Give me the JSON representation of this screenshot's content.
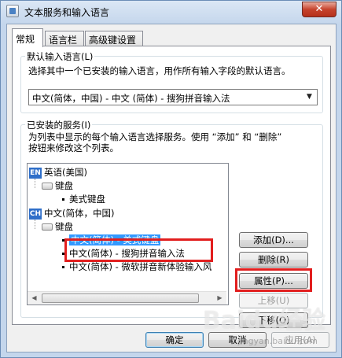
{
  "window": {
    "title": "文本服务和输入语言",
    "close_label": "✕"
  },
  "tabs": [
    {
      "label": "常规",
      "active": true
    },
    {
      "label": "语言栏",
      "active": false
    },
    {
      "label": "高级键设置",
      "active": false
    }
  ],
  "default_lang": {
    "group_label": "默认输入语言(L)",
    "description": "选择其中一个已安装的输入语言，用作所有输入字段的默认语言。",
    "selected": "中文(简体，中国) - 中文 (简体) - 搜狗拼音输入法"
  },
  "installed": {
    "group_label": "已安装的服务(I)",
    "description_line1": "为列表中显示的每个输入语言选择服务。使用 “添加” 和 “删除”",
    "description_line2": "按钮来修改这个列表。",
    "tree": {
      "lang1_badge": "EN",
      "lang1_label": "英语(美国)",
      "lang1_cat": "键盘",
      "lang1_item": "美式键盘",
      "lang2_badge": "CH",
      "lang2_label": "中文(简体，中国)",
      "lang2_cat": "键盘",
      "lang2_item1": "中文(简体) - 美式键盘",
      "lang2_item2": "中文(简体) - 搜狗拼音输入法",
      "lang2_item3": "中文(简体) - 微软拼音新体验输入风"
    },
    "buttons": {
      "add": "添加(D)...",
      "remove": "删除(R)",
      "properties": "属性(P)...",
      "move_up": "上移(U)",
      "move_down": "下移(O)"
    }
  },
  "footer": {
    "ok": "确定",
    "cancel": "取消",
    "apply": "应用(A)"
  },
  "watermark": {
    "brand": "Baidu经验",
    "url": "jingyan.baidu.com"
  },
  "colors": {
    "highlight": "#e21e1e",
    "selection": "#3399ff"
  }
}
